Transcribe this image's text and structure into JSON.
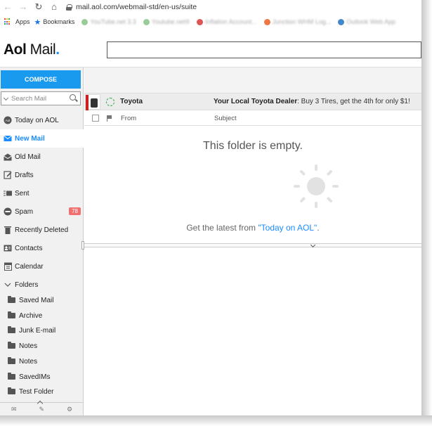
{
  "browser": {
    "url": "mail.aol.com/webmail-std/en-us/suite",
    "back_icon": "arrow-left-icon",
    "forward_icon": "arrow-right-icon",
    "reload_icon": "reload-icon",
    "home_icon": "home-icon"
  },
  "bookmarks": {
    "apps_label": "Apps",
    "bookmarks_label": "Bookmarks",
    "blurred_items": [
      "YouTube.net 3.3",
      "Youtube.net®",
      "Inflation Account...",
      "Junction WHM Log...",
      "Outlook Web App"
    ]
  },
  "header": {
    "logo_aol": "Aol",
    "logo_mail": "Mail",
    "logo_dot": ".",
    "accent_color": "#1a8cff"
  },
  "sidebar": {
    "compose_label": "COMPOSE",
    "search_placeholder": "Search Mail",
    "nav": [
      {
        "label": "Today on AOL",
        "icon": "aol-icon"
      },
      {
        "label": "New Mail",
        "icon": "envelope-icon",
        "active": true
      },
      {
        "label": "Old Mail",
        "icon": "open-envelope-icon"
      },
      {
        "label": "Drafts",
        "icon": "pencil-icon"
      },
      {
        "label": "Sent",
        "icon": "send-icon"
      },
      {
        "label": "Spam",
        "icon": "spam-icon",
        "badge": "78"
      },
      {
        "label": "Recently Deleted",
        "icon": "trash-icon"
      },
      {
        "label": "Contacts",
        "icon": "contacts-icon"
      },
      {
        "label": "Calendar",
        "icon": "calendar-icon"
      },
      {
        "label": "Folders",
        "icon": "chevron-down-icon"
      }
    ],
    "folders": [
      "Saved Mail",
      "Archive",
      "Junk E-mail",
      "Notes",
      "Notes",
      "SavedIMs",
      "Test Folder"
    ]
  },
  "mail": {
    "ad": {
      "sender": "Toyota",
      "subject": "Your Local Toyota Dealer",
      "preview": " : Buy 3 Tires, get the 4th for only $1!"
    },
    "columns": {
      "from": "From",
      "subject": "Subject"
    },
    "empty_title": "This folder is empty.",
    "empty_prefix": "Get the latest from ",
    "empty_link": "\"Today on AOL\"",
    "empty_suffix": "."
  }
}
